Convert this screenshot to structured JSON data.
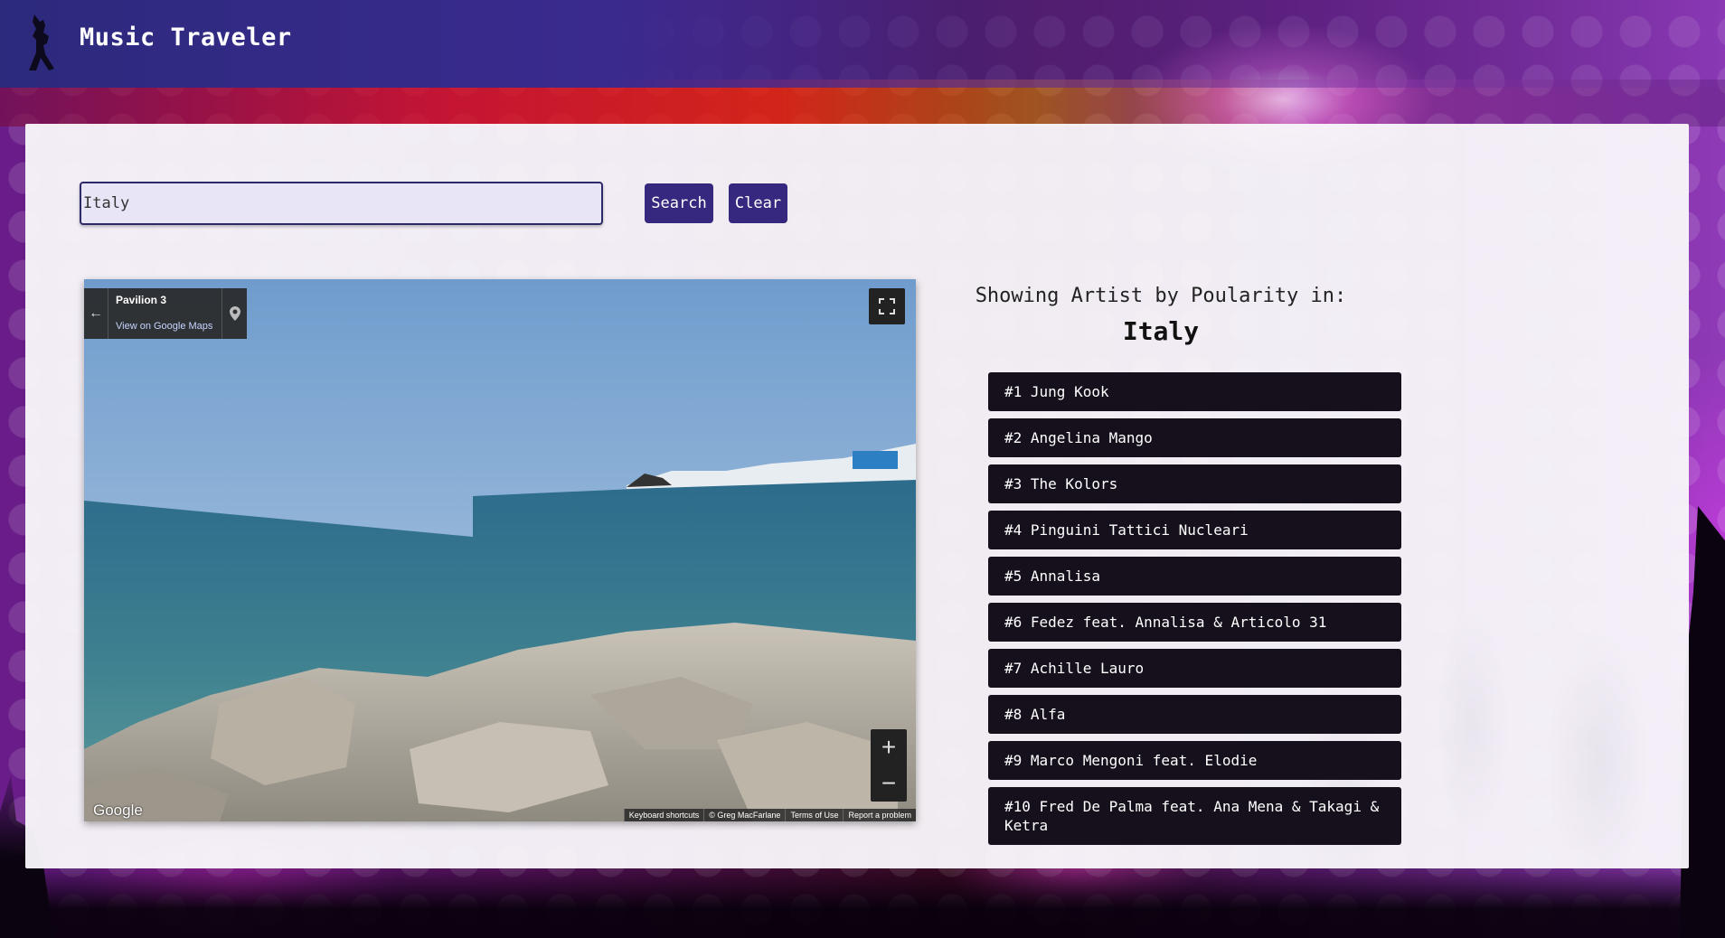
{
  "header": {
    "title": "Music Traveler"
  },
  "search": {
    "value": "Italy",
    "search_label": "Search",
    "clear_label": "Clear"
  },
  "streetview": {
    "location_title": "Pavilion 3",
    "link_text": "View on Google Maps",
    "zoom_in": "+",
    "zoom_out": "−",
    "google_label": "Google",
    "footer": [
      "Keyboard shortcuts",
      "© Greg MacFarlane",
      "Terms of Use",
      "Report a problem"
    ]
  },
  "results": {
    "subtitle": "Showing Artist by Poularity in:",
    "country": "Italy",
    "artists": [
      "#1 Jung Kook",
      "#2 Angelina Mango",
      "#3 The Kolors",
      "#4 Pinguini Tattici Nucleari",
      "#5 Annalisa",
      "#6 Fedez feat. Annalisa & Articolo 31",
      "#7 Achille Lauro",
      "#8 Alfa",
      "#9 Marco Mengoni feat. Elodie",
      "#10 Fred De Palma feat. Ana Mena & Takagi & Ketra"
    ]
  },
  "colors": {
    "header_bg": "#2c2a7d",
    "button_bg": "#36277f",
    "list_item_bg": "#15101c"
  }
}
